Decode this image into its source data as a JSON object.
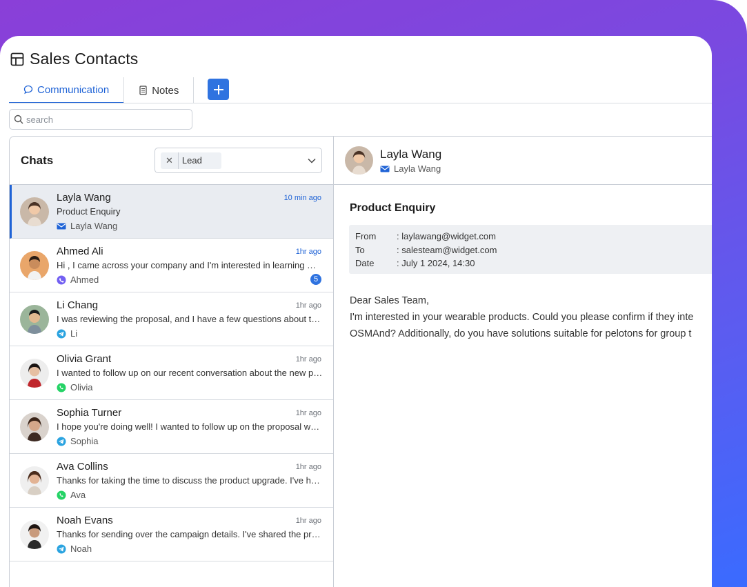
{
  "page": {
    "title": "Sales Contacts"
  },
  "tabs": [
    {
      "label": "Communication",
      "icon": "chat-bubble-icon",
      "active": true
    },
    {
      "label": "Notes",
      "icon": "document-icon",
      "active": false
    }
  ],
  "search": {
    "placeholder": "search",
    "value": ""
  },
  "chats": {
    "title": "Chats",
    "filter_chip": "Lead",
    "items": [
      {
        "name": "Layla Wang",
        "time": "10 min ago",
        "preview": "Product Enquiry",
        "source": "Layla Wang",
        "channel": "email",
        "unread": "",
        "selected": true
      },
      {
        "name": "Ahmed Ali",
        "time": "1hr ago",
        "preview": "Hi , I came across your company and I'm interested in learning more about your products",
        "source": "Ahmed",
        "channel": "viber",
        "unread": "5",
        "selected": false
      },
      {
        "name": "Li Chang",
        "time": "1hr ago",
        "preview": "I was reviewing the proposal, and I have a few questions about the pricing",
        "source": "Li",
        "channel": "telegram",
        "unread": "",
        "selected": false
      },
      {
        "name": "Olivia Grant",
        "time": "1hr ago",
        "preview": "I wanted to follow up on our recent conversation about the new product line",
        "source": "Olivia",
        "channel": "whatsapp",
        "unread": "",
        "selected": false
      },
      {
        "name": "Sophia Turner",
        "time": "1hr ago",
        "preview": "I hope you're doing well! I wanted to follow up on the proposal we sent over",
        "source": "Sophia",
        "channel": "telegram",
        "unread": "",
        "selected": false
      },
      {
        "name": "Ava Collins",
        "time": "1hr ago",
        "preview": "Thanks for taking the time to discuss the product upgrade. I've had a chance to review",
        "source": "Ava",
        "channel": "whatsapp",
        "unread": "",
        "selected": false
      },
      {
        "name": "Noah Evans",
        "time": "1hr ago",
        "preview": "Thanks for sending over the campaign details. I've shared the proposal with my team",
        "source": "Noah",
        "channel": "telegram",
        "unread": "",
        "selected": false
      }
    ]
  },
  "detail": {
    "name": "Layla Wang",
    "sub": "Layla Wang",
    "subject": "Product Enquiry",
    "meta": [
      {
        "label": "From",
        "value": ": laylawang@widget.com"
      },
      {
        "label": "To",
        "value": ": salesteam@widget.com"
      },
      {
        "label": "Date",
        "value": ": July 1 2024, 14:30"
      }
    ],
    "body": [
      "Dear Sales Team,",
      "I'm interested in your wearable products. Could you please confirm if they inte",
      "OSMAnd? Additionally, do you have solutions suitable for pelotons for group t"
    ]
  },
  "colors": {
    "accent": "#1f63d6",
    "button": "#2f73e0",
    "gradient_start": "#8a3fd8",
    "gradient_end": "#3a6bff",
    "whatsapp": "#25d366",
    "telegram": "#2aa3e0",
    "viber": "#7360f2"
  }
}
